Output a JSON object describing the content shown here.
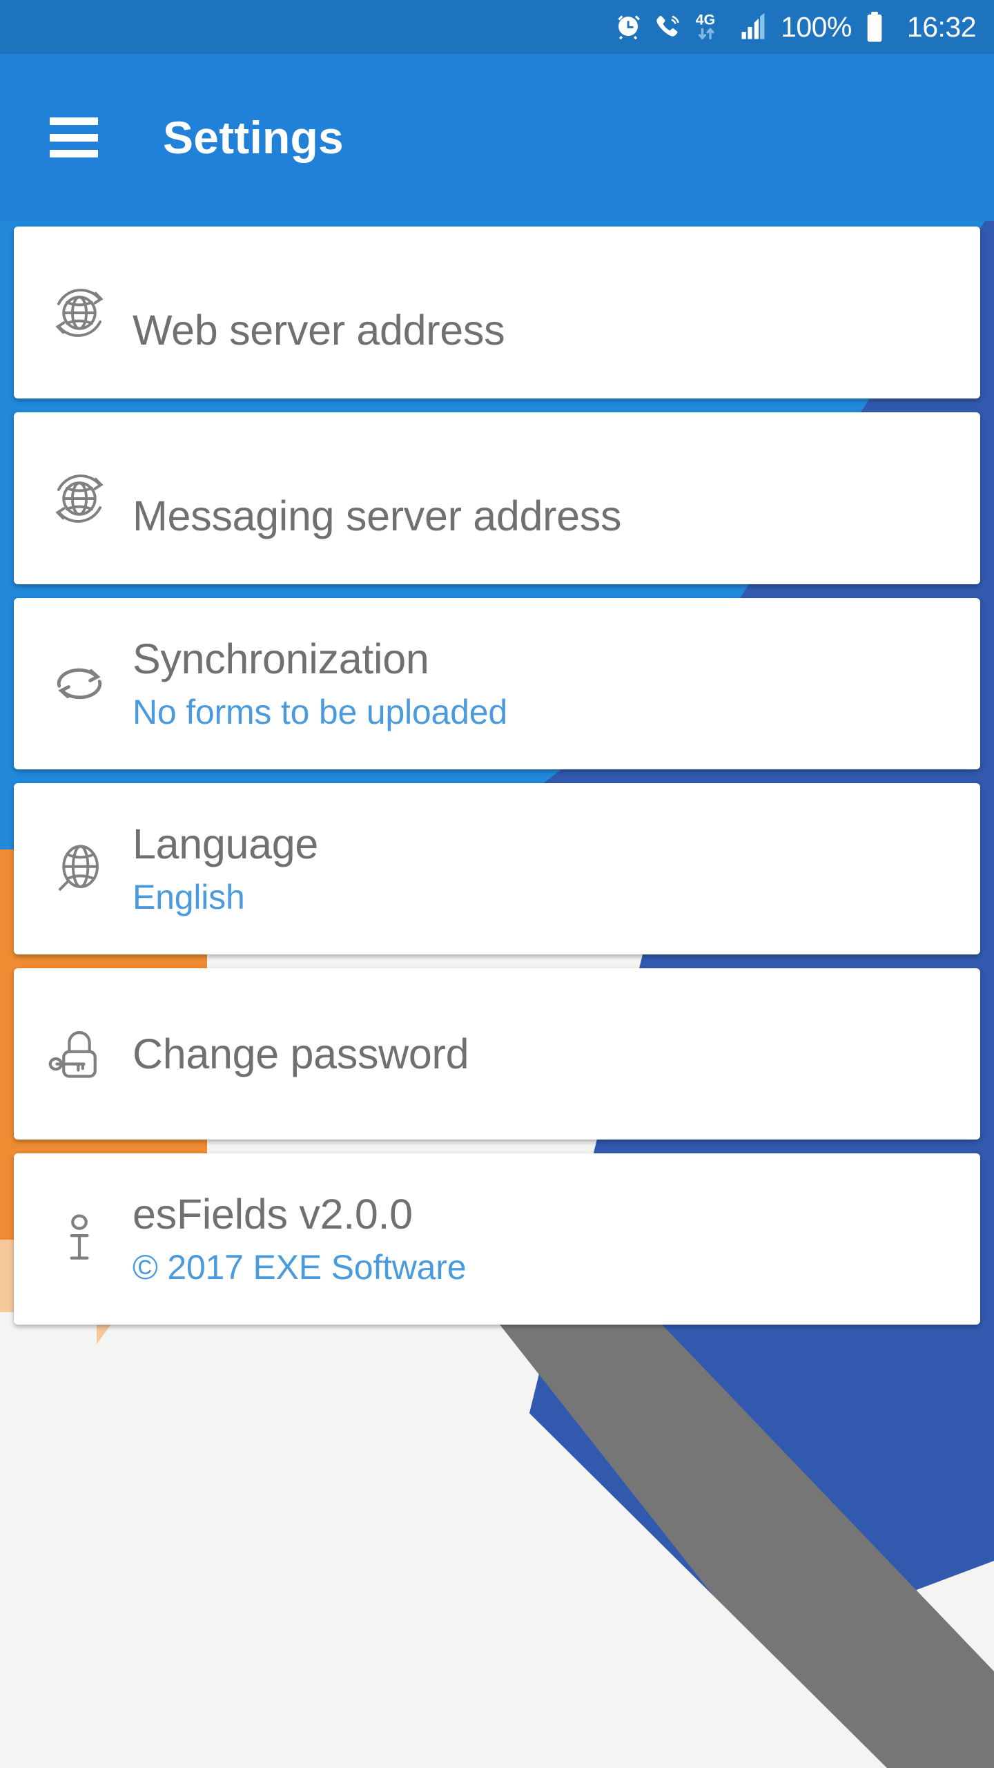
{
  "status_bar": {
    "alarm_icon": "alarm-clock-icon",
    "ringer_icon": "phone-ringing-icon",
    "network_label": "4G",
    "data_arrows_icon": "data-transfer-arrows-icon",
    "signal_icon": "signal-bars-icon",
    "battery_percent": "100%",
    "battery_icon": "battery-full-icon",
    "clock": "16:32"
  },
  "app_bar": {
    "menu_icon": "hamburger-menu-icon",
    "title": "Settings"
  },
  "settings": {
    "items": [
      {
        "id": "web-server-address",
        "icon": "globe-sync-icon",
        "title": "Web server address",
        "subtitle": ""
      },
      {
        "id": "messaging-server-address",
        "icon": "globe-sync-icon",
        "title": "Messaging server address",
        "subtitle": ""
      },
      {
        "id": "synchronization",
        "icon": "sync-arrows-icon",
        "title": "Synchronization",
        "subtitle": "No forms to be uploaded"
      },
      {
        "id": "language",
        "icon": "globe-speech-icon",
        "title": "Language",
        "subtitle": "English"
      },
      {
        "id": "change-password",
        "icon": "padlock-key-icon",
        "title": "Change password",
        "subtitle": ""
      },
      {
        "id": "about-version",
        "icon": "info-icon",
        "title": "esFields v2.0.0",
        "subtitle": "© 2017 EXE Software"
      }
    ]
  },
  "colors": {
    "status_bar": "#1E73BE",
    "app_bar": "#2180D8",
    "accent_blue": "#4A9BDD",
    "title_gray": "#707070",
    "card_white": "#FFFFFF",
    "bg_light_blue": "#2188DA",
    "bg_dark_blue": "#3159AE",
    "bg_orange": "#EE8B33",
    "bg_peach": "#F6C79B",
    "bg_gray": "#767676",
    "bg_offwhite": "#F4F4F2"
  }
}
